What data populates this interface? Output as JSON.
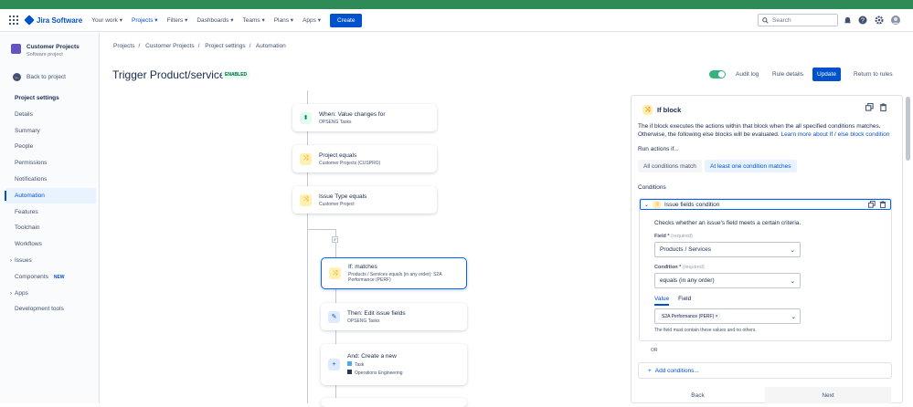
{
  "topnav": {
    "brand": "Jira Software",
    "items": [
      "Your work",
      "Projects",
      "Filters",
      "Dashboards",
      "Teams",
      "Plans",
      "Apps"
    ],
    "active_item": "Projects",
    "create_label": "Create",
    "search_placeholder": "Search"
  },
  "sidebar": {
    "project_name": "Customer Projects",
    "project_type": "Software project",
    "back_label": "Back to project",
    "section_heading": "Project settings",
    "items": [
      {
        "label": "Details"
      },
      {
        "label": "Summary"
      },
      {
        "label": "People"
      },
      {
        "label": "Permissions"
      },
      {
        "label": "Notifications"
      },
      {
        "label": "Automation",
        "selected": true
      },
      {
        "label": "Features"
      },
      {
        "label": "Toolchain"
      },
      {
        "label": "Workflows"
      },
      {
        "label": "Issues",
        "expandable": true
      },
      {
        "label": "Components",
        "badge": "NEW"
      },
      {
        "label": "Apps",
        "expandable": true
      },
      {
        "label": "Development tools"
      }
    ]
  },
  "breadcrumbs": [
    "Projects",
    "Customer Projects",
    "Project settings",
    "Automation"
  ],
  "rule": {
    "title": "Trigger Product/services",
    "status": "ENABLED",
    "enabled": true
  },
  "toolbar": {
    "audit_log": "Audit log",
    "rule_details": "Rule details",
    "update": "Update",
    "return": "Return to rules"
  },
  "flow": {
    "cards": [
      {
        "title": "When: Value changes for",
        "sub": "OPSENG Tasks",
        "icon": "trigger-icon"
      },
      {
        "title": "Project equals",
        "sub": "Customer Projects (CUSPRO)",
        "icon": "condition-icon"
      },
      {
        "title": "Issue Type equals",
        "sub": "Customer Project",
        "icon": "condition-icon"
      },
      {
        "title": "If: matches",
        "sub": "Products / Services equals (in any order): S2A Performance (PERF)",
        "icon": "if-block-icon"
      },
      {
        "title": "Then: Edit issue fields",
        "sub": "OPSENG Tasks",
        "icon": "edit-icon"
      },
      {
        "title": "And: Create a new",
        "sub1": "Task",
        "sub2": "Operations Engineering",
        "icon": "plus-icon"
      }
    ],
    "if_tag": "IF"
  },
  "panel": {
    "title": "If block",
    "description": "The if block executes the actions within that block when the all specified conditions matches. Otherwise, the following else blocks will be evaluated.",
    "learn_more": "Learn more about If / else block condition",
    "run_actions_label": "Run actions if...",
    "option_all": "All conditions match",
    "option_any": "At least one condition matches",
    "conditions_label": "Conditions",
    "condition": {
      "name": "Issue fields condition",
      "description": "Checks whether an issue's field meets a certain criteria.",
      "field_label": "Field *",
      "field_required": "(required)",
      "field_value": "Products / Services",
      "cond_label": "Condition *",
      "cond_required": "(required)",
      "cond_value": "equals (in any order)",
      "tab_value": "Value",
      "tab_field": "Field",
      "chip": "S2A Performance (PERF)",
      "note": "The field must contain these values and no others."
    },
    "or_label": "OR",
    "add_conditions": "Add conditions...",
    "back": "Back",
    "next": "Next"
  },
  "colors": {
    "brand": "#0052cc",
    "topstrip": "#2e8b57",
    "toggle_on": "#36b37e"
  }
}
